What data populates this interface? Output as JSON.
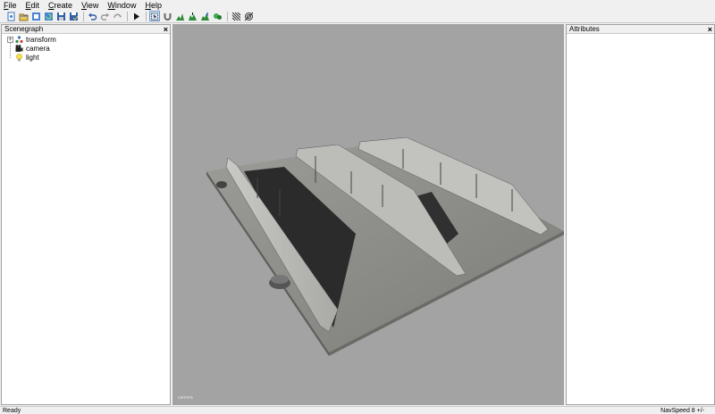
{
  "menubar": {
    "items": [
      "File",
      "Edit",
      "Create",
      "View",
      "Window",
      "Help"
    ]
  },
  "toolbar": {
    "buttons": [
      {
        "icon": "new-icon"
      },
      {
        "icon": "open-icon"
      },
      {
        "icon": "import-icon"
      },
      {
        "icon": "reload-icon"
      },
      {
        "icon": "save-icon"
      },
      {
        "icon": "save-as-icon"
      },
      {
        "icon": "undo-icon"
      },
      {
        "icon": "redo-icon"
      },
      {
        "icon": "redo-alt-icon"
      },
      {
        "icon": "play-icon"
      },
      {
        "icon": "select-icon"
      },
      {
        "icon": "magnet-icon"
      },
      {
        "icon": "terrain-icon"
      },
      {
        "icon": "terrain-raise-icon"
      },
      {
        "icon": "terrain-paint-icon"
      },
      {
        "icon": "vegetation-icon"
      },
      {
        "icon": "pattern-icon"
      },
      {
        "icon": "pattern-alt-icon"
      }
    ]
  },
  "scenegraph": {
    "title": "Scenegraph",
    "close": "×",
    "items": [
      {
        "label": "transform",
        "icon": "transform-icon",
        "expander": "+"
      },
      {
        "label": "camera",
        "icon": "camera-icon"
      },
      {
        "label": "light",
        "icon": "light-bulb-icon"
      }
    ]
  },
  "attributes": {
    "title": "Attributes",
    "close": "×"
  },
  "viewport": {
    "label": "camera"
  },
  "statusbar": {
    "left": "Ready",
    "right": "NavSpeed 8 +/-"
  },
  "colors": {
    "viewport_bg": "#a3a3a3",
    "floor": "#8d8d8a",
    "wall_light": "#c6c6c3",
    "wall_shadow": "#2d2d2d"
  }
}
